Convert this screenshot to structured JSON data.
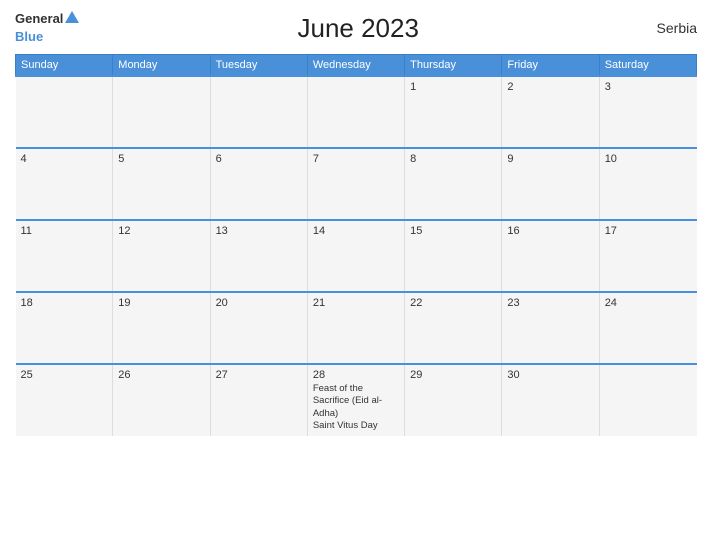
{
  "header": {
    "logo_general": "General",
    "logo_blue": "Blue",
    "title": "June 2023",
    "country": "Serbia"
  },
  "days_of_week": [
    "Sunday",
    "Monday",
    "Tuesday",
    "Wednesday",
    "Thursday",
    "Friday",
    "Saturday"
  ],
  "weeks": [
    [
      {
        "day": "",
        "events": []
      },
      {
        "day": "",
        "events": []
      },
      {
        "day": "",
        "events": []
      },
      {
        "day": "",
        "events": []
      },
      {
        "day": "1",
        "events": []
      },
      {
        "day": "2",
        "events": []
      },
      {
        "day": "3",
        "events": []
      }
    ],
    [
      {
        "day": "4",
        "events": []
      },
      {
        "day": "5",
        "events": []
      },
      {
        "day": "6",
        "events": []
      },
      {
        "day": "7",
        "events": []
      },
      {
        "day": "8",
        "events": []
      },
      {
        "day": "9",
        "events": []
      },
      {
        "day": "10",
        "events": []
      }
    ],
    [
      {
        "day": "11",
        "events": []
      },
      {
        "day": "12",
        "events": []
      },
      {
        "day": "13",
        "events": []
      },
      {
        "day": "14",
        "events": []
      },
      {
        "day": "15",
        "events": []
      },
      {
        "day": "16",
        "events": []
      },
      {
        "day": "17",
        "events": []
      }
    ],
    [
      {
        "day": "18",
        "events": []
      },
      {
        "day": "19",
        "events": []
      },
      {
        "day": "20",
        "events": []
      },
      {
        "day": "21",
        "events": []
      },
      {
        "day": "22",
        "events": []
      },
      {
        "day": "23",
        "events": []
      },
      {
        "day": "24",
        "events": []
      }
    ],
    [
      {
        "day": "25",
        "events": []
      },
      {
        "day": "26",
        "events": []
      },
      {
        "day": "27",
        "events": []
      },
      {
        "day": "28",
        "events": [
          "Feast of the Sacrifice (Eid al-Adha)",
          "Saint Vitus Day"
        ]
      },
      {
        "day": "29",
        "events": []
      },
      {
        "day": "30",
        "events": []
      },
      {
        "day": "",
        "events": []
      }
    ]
  ],
  "colors": {
    "header_bg": "#4a90d9",
    "row_bg": "#f5f5f5",
    "border": "#4a90d9"
  }
}
